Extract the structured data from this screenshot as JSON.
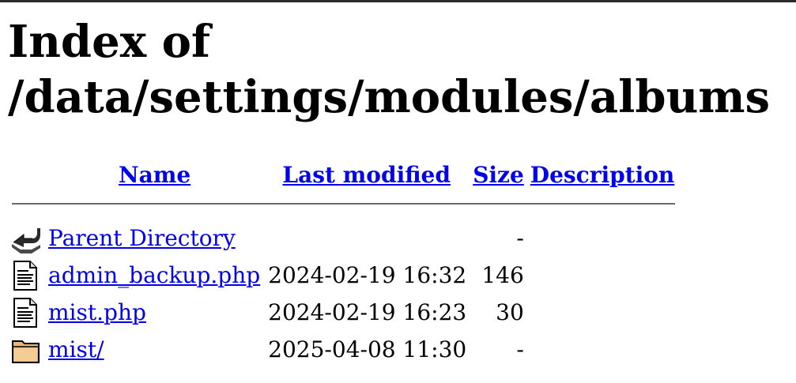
{
  "page": {
    "title": "Index of /data/settings/modules/albums"
  },
  "columns": {
    "name": "Name",
    "last_modified": "Last modified",
    "size": "Size",
    "description": "Description"
  },
  "entries": [
    {
      "icon": "back-icon",
      "name": "Parent Directory",
      "date": "",
      "size": "-",
      "description": ""
    },
    {
      "icon": "text-file-icon",
      "name": "admin_backup.php",
      "date": "2024-02-19 16:32",
      "size": "146",
      "description": ""
    },
    {
      "icon": "text-file-icon",
      "name": "mist.php",
      "date": "2024-02-19 16:23",
      "size": "30",
      "description": ""
    },
    {
      "icon": "folder-icon",
      "name": "mist/",
      "date": "2025-04-08 11:30",
      "size": "-",
      "description": ""
    }
  ]
}
